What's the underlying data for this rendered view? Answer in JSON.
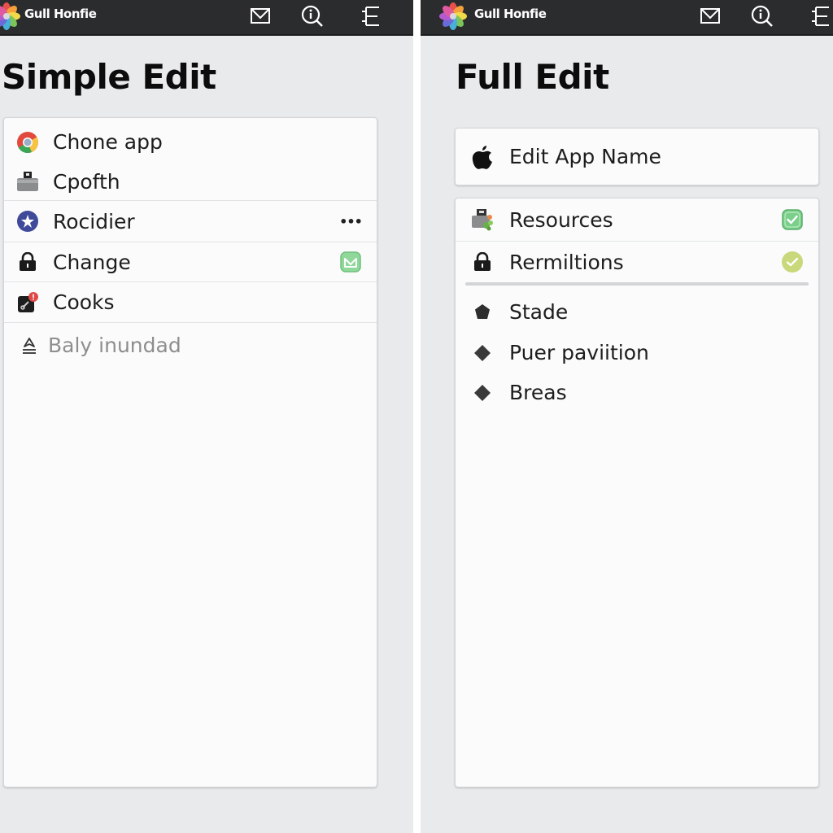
{
  "app": {
    "brand": "Gull Honfie",
    "topbar_icons": [
      "mail-icon",
      "info-search-icon",
      "menu-list-icon"
    ]
  },
  "left_panel": {
    "title": "Simple Edit",
    "items": [
      {
        "label": "Chone app",
        "icon": "chrome-icon",
        "trailing": null
      },
      {
        "label": "Cpofth",
        "icon": "printer-icon",
        "trailing": null
      },
      {
        "label": "Rocidier",
        "icon": "star-badge-icon",
        "trailing": "more-icon",
        "trailing_text": "•••"
      },
      {
        "label": "Change",
        "icon": "lock-icon",
        "trailing": "check-badge-icon"
      },
      {
        "label": "Cooks",
        "icon": "notification-badge-icon",
        "trailing": null
      },
      {
        "label": "Baly inundad",
        "icon": "upload-icon",
        "trailing": null,
        "muted": true
      }
    ]
  },
  "right_panel": {
    "title": "Full Edit",
    "name_field": {
      "label": "Edit App Name",
      "icon": "apple-icon"
    },
    "items": [
      {
        "label": "Resources",
        "icon": "resources-icon",
        "trailing": "check-square-icon",
        "status": "checked"
      },
      {
        "label": "Rermiltions",
        "icon": "lock-icon",
        "trailing": "check-circle-icon",
        "status": "checked"
      }
    ],
    "sub_items": [
      {
        "label": "Stade",
        "icon": "pentagon-icon"
      },
      {
        "label": "Puer paviition",
        "icon": "diamond-icon"
      },
      {
        "label": "Breas",
        "icon": "diamond-icon"
      }
    ]
  },
  "colors": {
    "topbar": "#2b2c2e",
    "panel_bg": "#e8eaeb",
    "card_bg": "#fbfbfb",
    "check_green": "#7ccf8a",
    "check_lime": "#c9d87a",
    "star_badge": "#3f4a9a",
    "notify_red": "#e04848"
  }
}
